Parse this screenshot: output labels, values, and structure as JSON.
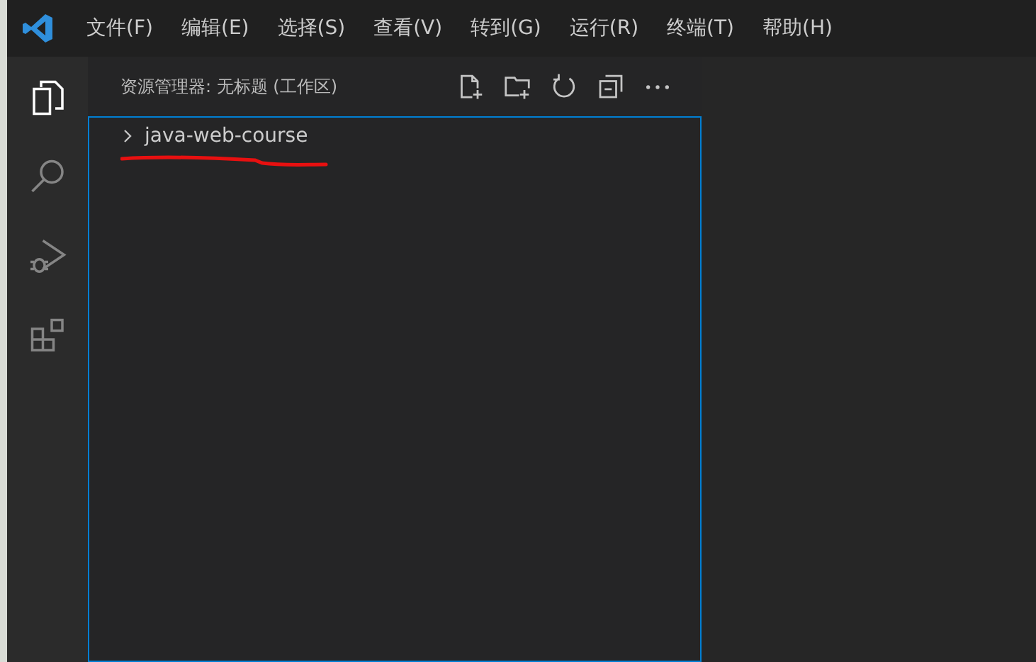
{
  "menu": [
    "文件(F)",
    "编辑(E)",
    "选择(S)",
    "查看(V)",
    "转到(G)",
    "运行(R)",
    "终端(T)",
    "帮助(H)"
  ],
  "activity_bar": [
    {
      "kind": "files",
      "selected": true
    },
    {
      "kind": "search",
      "selected": false
    },
    {
      "kind": "debug",
      "selected": false
    },
    {
      "kind": "extensions",
      "selected": false
    }
  ],
  "explorer": {
    "title": "资源管理器: 无标题 (工作区)",
    "actions": [
      {
        "kind": "new-file"
      },
      {
        "kind": "new-folder"
      },
      {
        "kind": "refresh"
      },
      {
        "kind": "collapse"
      },
      {
        "kind": "more"
      }
    ],
    "tree": [
      {
        "label": "java-web-course",
        "expanded": false
      }
    ]
  }
}
